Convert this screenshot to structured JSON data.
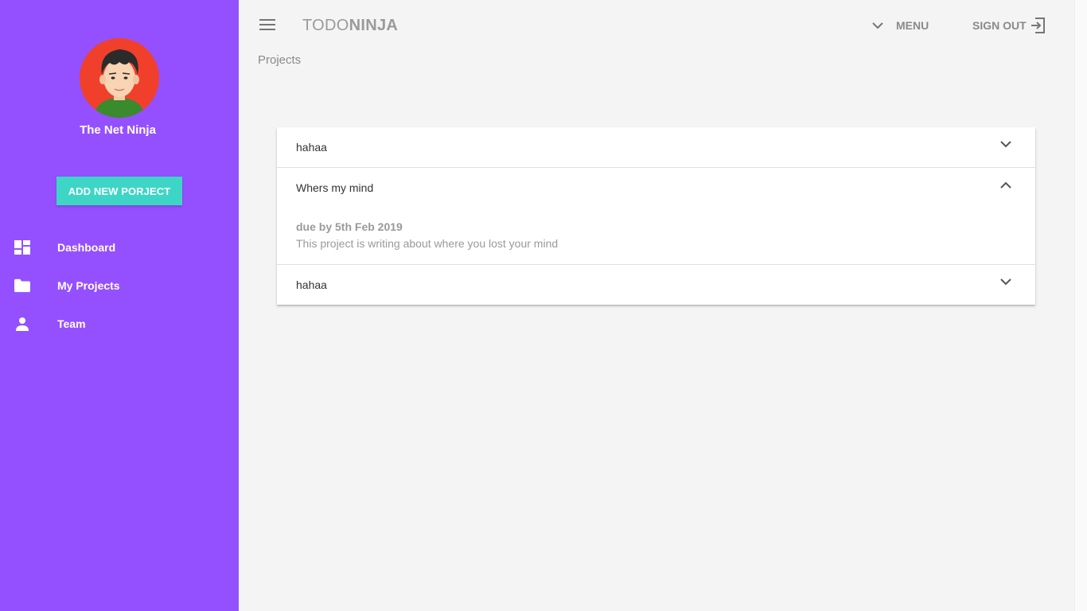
{
  "sidebar": {
    "user_name": "The Net Ninja",
    "add_button": "ADD NEW PORJECT",
    "items": [
      {
        "label": "Dashboard",
        "icon": "dashboard-icon"
      },
      {
        "label": "My Projects",
        "icon": "folder-icon"
      },
      {
        "label": "Team",
        "icon": "person-icon"
      }
    ],
    "bg_color": "#9450ff",
    "button_color": "#3dd6c6"
  },
  "toolbar": {
    "brand_light": "TODO",
    "brand_bold": "NINJA",
    "menu_label": "MENU",
    "signout_label": "SIGN OUT"
  },
  "page": {
    "title": "Projects"
  },
  "projects": [
    {
      "title": "hahaa",
      "expanded": false
    },
    {
      "title": "Whers my mind",
      "expanded": true,
      "due": "due by 5th Feb 2019",
      "content": "This project is writing about where you lost your mind"
    },
    {
      "title": "hahaa",
      "expanded": false
    }
  ]
}
